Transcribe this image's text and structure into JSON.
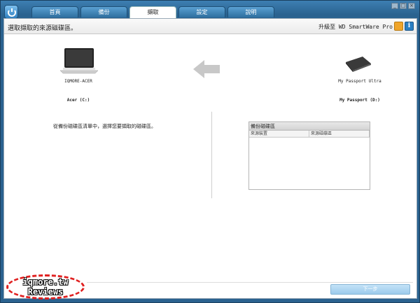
{
  "window": {
    "tabs": [
      {
        "label": "首頁"
      },
      {
        "label": "備份"
      },
      {
        "label": "擷取"
      },
      {
        "label": "設定"
      },
      {
        "label": "說明"
      }
    ],
    "active_tab": 2
  },
  "header": {
    "prompt": "選取擷取的來源磁碟區。",
    "upgrade": "升級至 WD SmartWare Pro"
  },
  "source": {
    "computer_name": "IQMORE-ACER",
    "drive_label": "Acer (C:)"
  },
  "destination": {
    "device_name": "My Passport Ultra",
    "drive_label": "My Passport (D:)"
  },
  "instruction": "從備份磁碟區清單中，選擇您要擷取的磁碟區。",
  "backup_list": {
    "title": "備份磁碟區",
    "columns": [
      "來源裝置",
      "來源磁碟區"
    ]
  },
  "next_button": "下一步",
  "watermark": {
    "line1": "iqmore.tw",
    "line2": "Reviews"
  }
}
